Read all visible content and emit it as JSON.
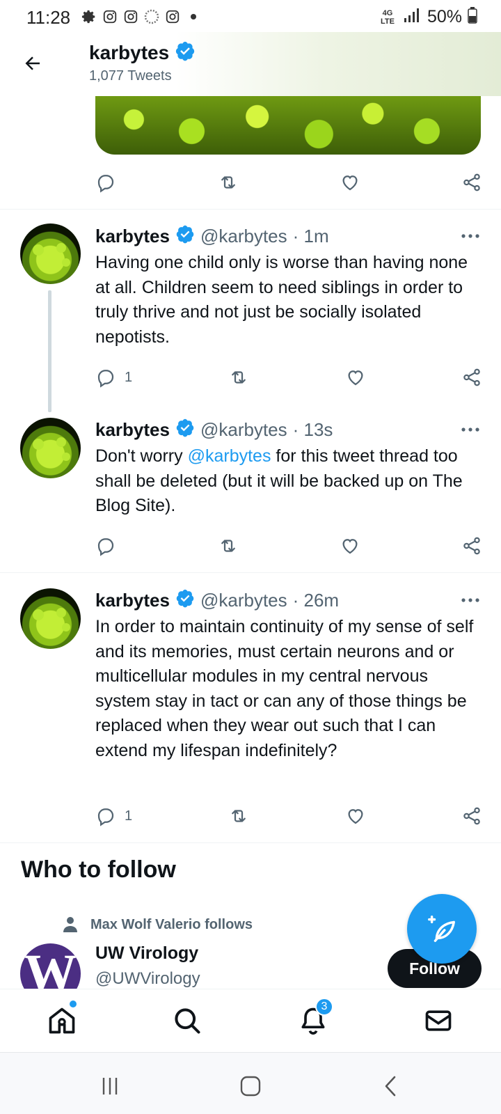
{
  "status_bar": {
    "time": "11:28",
    "network": "4G LTE",
    "battery": "50%",
    "icons_left": [
      "settings-icon",
      "instagram-icon",
      "instagram-icon",
      "loading-icon",
      "instagram-icon",
      "dot-icon"
    ]
  },
  "header": {
    "name": "karbytes",
    "tweet_count": "1,077 Tweets"
  },
  "tweets": [
    {
      "name": "karbytes",
      "handle": "@karbytes",
      "time": "· 1m",
      "text": "Having one child only is worse than having none at all. Children seem to need siblings in order to truly thrive and not just be socially isolated nepotists.",
      "replies": "1",
      "retweets": "",
      "likes": ""
    },
    {
      "name": "karbytes",
      "handle": "@karbytes",
      "time": "· 13s",
      "text_before": "Don't worry ",
      "mention": "@karbytes",
      "text_after": " for this tweet thread too shall be deleted (but it will be backed up on The Blog Site).",
      "replies": "",
      "retweets": "",
      "likes": ""
    },
    {
      "name": "karbytes",
      "handle": "@karbytes",
      "time": "· 26m",
      "text": "In order to maintain continuity of my sense of self and its memories, must certain neurons and or multicellular modules in my central nervous system stay in tact or can any of those things be replaced when they wear out such that I can extend my lifespan indefinitely?",
      "replies": "1",
      "retweets": "",
      "likes": ""
    }
  ],
  "who_to_follow": {
    "title": "Who to follow",
    "context": "Max Wolf Valerio follows",
    "name": "UW Virology",
    "handle": "@UWVirology",
    "avatar_letter": "W",
    "follow_label": "Follow"
  },
  "bottom_nav": {
    "notifications_badge": "3"
  },
  "colors": {
    "accent": "#1d9bf0",
    "text": "#0f1419",
    "secondary": "#536471",
    "uw_purple": "#4b2e83"
  }
}
